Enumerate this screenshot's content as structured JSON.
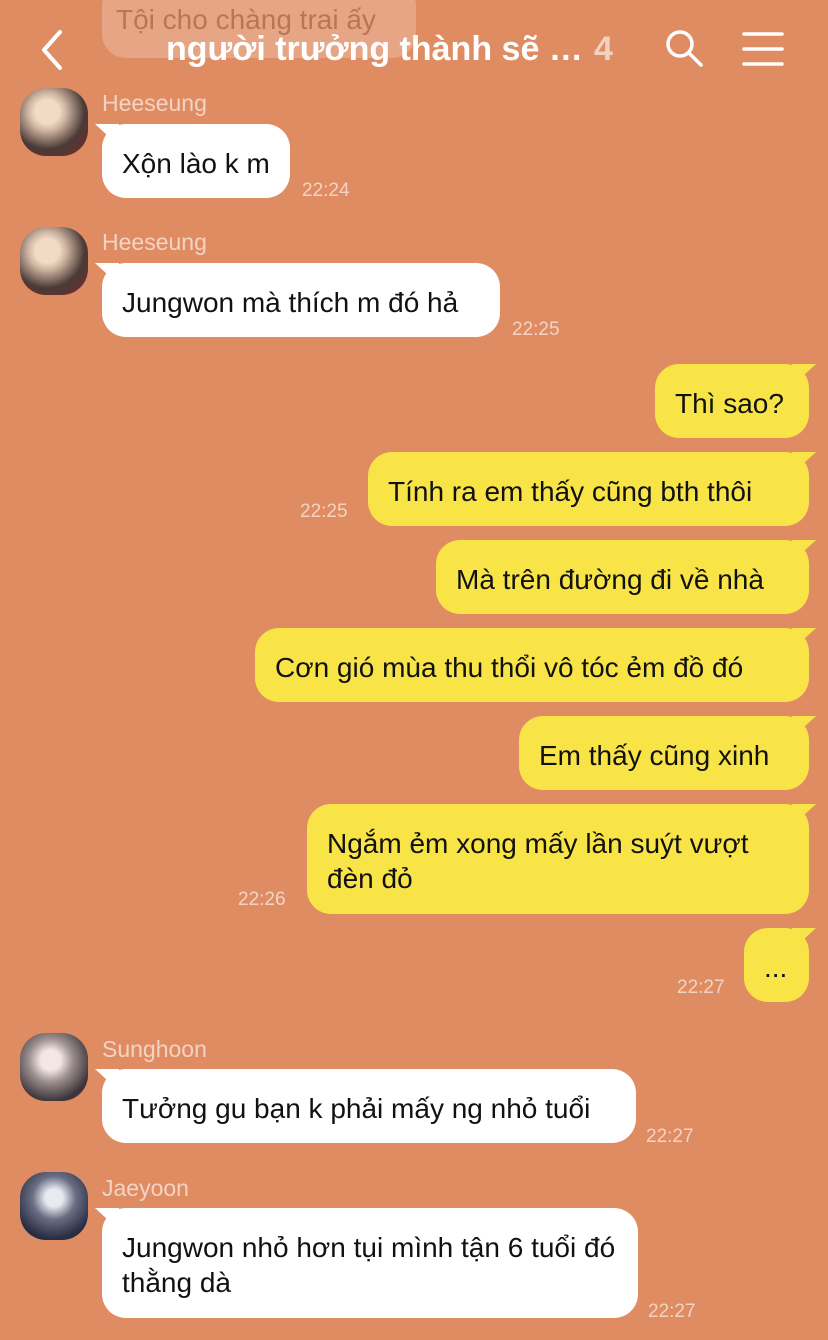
{
  "header": {
    "title": "người trưởng thành sẽ th...",
    "member_count": "4",
    "icons": [
      "back-icon",
      "search-icon",
      "menu-icon"
    ]
  },
  "colors": {
    "background": "#E08C63",
    "outgoing_bubble": "#F8E446",
    "incoming_bubble": "#FFFFFF"
  },
  "ghost_message": "Tội cho chàng trai ấy",
  "messages": [
    {
      "sender": "Heeseung",
      "text": "Xộn lào k m",
      "time": "22:24"
    },
    {
      "sender": "Heeseung",
      "text": "Jungwon mà thích m đó hả",
      "time": "22:25"
    },
    {
      "text": "Thì sao?"
    },
    {
      "text": "Tính ra em thấy cũng bth thôi",
      "time": "22:25"
    },
    {
      "text": "Mà trên đường đi về nhà"
    },
    {
      "text": "Cơn gió mùa thu thổi vô tóc ẻm đồ đó"
    },
    {
      "text": "Em thấy cũng xinh"
    },
    {
      "text": "Ngắm ẻm xong mấy lần suýt vượt đèn đỏ",
      "time": "22:26"
    },
    {
      "text": "...",
      "time": "22:27"
    },
    {
      "sender": "Sunghoon",
      "text": "Tưởng gu bạn k phải mấy ng nhỏ tuổi",
      "time": "22:27"
    },
    {
      "sender": "Jaeyoon",
      "text": "Jungwon nhỏ hơn tụi mình tận 6 tuổi đó thằng dà",
      "time": "22:27"
    }
  ]
}
